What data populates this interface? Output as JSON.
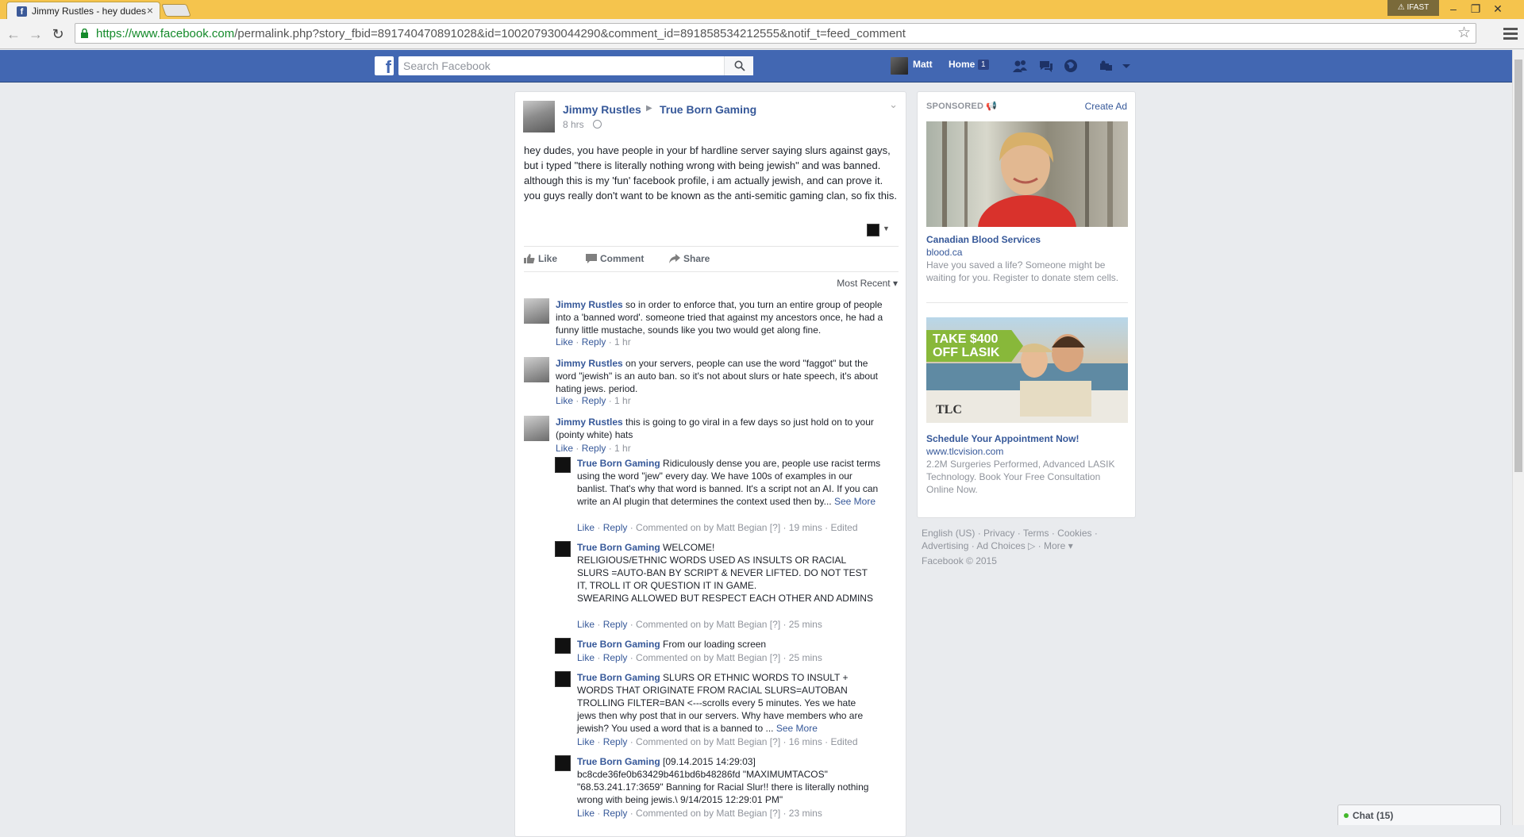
{
  "browser": {
    "tab_title": "Jimmy Rustles - hey dudes",
    "tab_close": "×",
    "badge": "IFAST",
    "url_secure": "https://www.facebook.com",
    "url_path": "/permalink.php?story_fbid=891740470891028&id=100207930044290&comment_id=891858534212555&notif_t=feed_comment",
    "minimize": "–",
    "restore": "❐",
    "close": "✕"
  },
  "fb": {
    "search_placeholder": "Search Facebook",
    "user_name": "Matt",
    "home_label": "Home",
    "home_count": "1",
    "brand_color": "#4267b2"
  },
  "post": {
    "author": "Jimmy Rustles",
    "arrow": "▶",
    "group": "True Born Gaming",
    "time": "8 hrs",
    "body": "hey dudes, you have people in your bf hardline server saying slurs against gays, but i typed \"there is literally nothing wrong with being jewish\" and was banned. although this is my 'fun' facebook profile, i am actually jewish, and can prove it. you guys really don't want to be known as the anti-semitic gaming clan, so fix this.",
    "like_label": "Like",
    "comment_label": "Comment",
    "share_label": "Share",
    "sort_label": "Most Recent ▾"
  },
  "comments": [
    {
      "name": "Jimmy Rustles",
      "text": "so in order to enforce that, you turn an entire group of people into a 'banned word'. someone tried that against my ancestors once, he had a funny little mustache, sounds like you two would get along fine.",
      "more": "",
      "like": "Like",
      "reply": "Reply",
      "meta": "· 1 hr"
    },
    {
      "name": "Jimmy Rustles",
      "text": "on your servers, people can use the word \"faggot\" but the word \"jewish\" is an auto ban. so it's not about slurs or hate speech, it's about hating jews. period.",
      "more": "",
      "like": "Like",
      "reply": "Reply",
      "meta": "· 1 hr"
    },
    {
      "name": "Jimmy Rustles",
      "text": "this is going to go viral in a few days so just hold on to your (pointy white) hats",
      "more": "",
      "like": "Like",
      "reply": "Reply",
      "meta": "· 1 hr"
    },
    {
      "name": "True Born Gaming",
      "text": "Ridiculously dense you are, people use racist terms using the word \"jew\" every day. We have 100s of examples in our banlist. That's why that word is banned. It's a script not an AI. If you can write an AI plugin that determines the context used then by...",
      "more": "See More",
      "like": "Like",
      "reply": "Reply",
      "meta": "· Commented on by Matt Begian [?] · 19 mins · Edited"
    },
    {
      "name": "True Born Gaming",
      "text": "WELCOME!\nRELIGIOUS/ETHNIC WORDS USED AS INSULTS OR RACIAL SLURS =AUTO-BAN BY SCRIPT & NEVER LIFTED. DO NOT TEST IT, TROLL IT OR QUESTION IT IN GAME.\nSWEARING ALLOWED BUT RESPECT EACH OTHER AND ADMINS",
      "more": "",
      "like": "Like",
      "reply": "Reply",
      "meta": "· Commented on by Matt Begian [?] · 25 mins"
    },
    {
      "name": "True Born Gaming",
      "text": "From our loading screen",
      "more": "",
      "like": "Like",
      "reply": "Reply",
      "meta": "· Commented on by Matt Begian [?] · 25 mins"
    },
    {
      "name": "True Born Gaming",
      "text": "SLURS OR ETHNIC WORDS TO INSULT + WORDS THAT ORIGINATE FROM RACIAL SLURS=AUTOBAN TROLLING FILTER=BAN <---scrolls every 5 minutes. Yes we hate jews then why post that in our servers. Why have members who are jewish? You used a word that is a banned to ...",
      "more": "See More",
      "like": "Like",
      "reply": "Reply",
      "meta": "· Commented on by Matt Begian [?] · 16 mins · Edited"
    },
    {
      "name": "True Born Gaming",
      "text": "[09.14.2015 14:29:03] bc8cde36fe0b63429b461bd6b48286fd \"MAXIMUMTACOS\" \"68.53.241.17:3659\" Banning for Racial Slur!! there is literally nothing wrong with being jewis.\\ 9/14/2015 12:29:01 PM\"",
      "more": "",
      "like": "Like",
      "reply": "Reply",
      "meta": "· Commented on by Matt Begian [?] · 23 mins"
    }
  ],
  "sidebar": {
    "sponsored": "SPONSORED",
    "create_ad": "Create Ad",
    "ads": [
      {
        "title": "Canadian Blood Services",
        "domain": "blood.ca",
        "desc": "Have you saved a life? Someone might be waiting for you. Register to donate stem cells."
      },
      {
        "title": "Schedule Your Appointment Now!",
        "domain": "www.tlcvision.com",
        "desc": "2.2M Surgeries Performed, Advanced LASIK Technology. Book Your Free Consultation Online Now.",
        "tag": "TAKE $400 OFF LASIK",
        "logo": "TLC"
      }
    ]
  },
  "footer": {
    "lang": "English (US)",
    "privacy": "Privacy",
    "terms": "Terms",
    "cookies": "Cookies",
    "advertising": "Advertising",
    "ad_choices": "Ad Choices",
    "more": "More ▾",
    "copyright": "Facebook © 2015"
  },
  "chat": {
    "label": "Chat (15)"
  }
}
